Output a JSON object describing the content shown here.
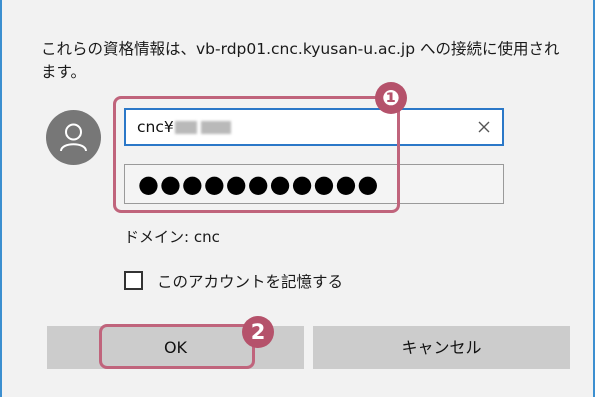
{
  "dialog": {
    "message": "これらの資格情報は、vb-rdp01.cnc.kyusan-u.ac.jp への接続に使用されます。",
    "username_field": {
      "value": "cnc¥",
      "clear_icon": "close-icon"
    },
    "password_field": {
      "value": "●●●●●●●●●●●"
    },
    "domain_text": "ドメイン: cnc",
    "remember_checkbox": {
      "label": "このアカウントを記憶する",
      "checked": false
    },
    "buttons": {
      "ok": "OK",
      "cancel": "キャンセル"
    }
  },
  "annotations": {
    "badge_1": "❶",
    "badge_2": "2"
  },
  "colors": {
    "highlight": "#c0647c",
    "badge": "#b5526b",
    "focus_border": "#2b78c8",
    "dialog_border": "#3c8fd0"
  }
}
